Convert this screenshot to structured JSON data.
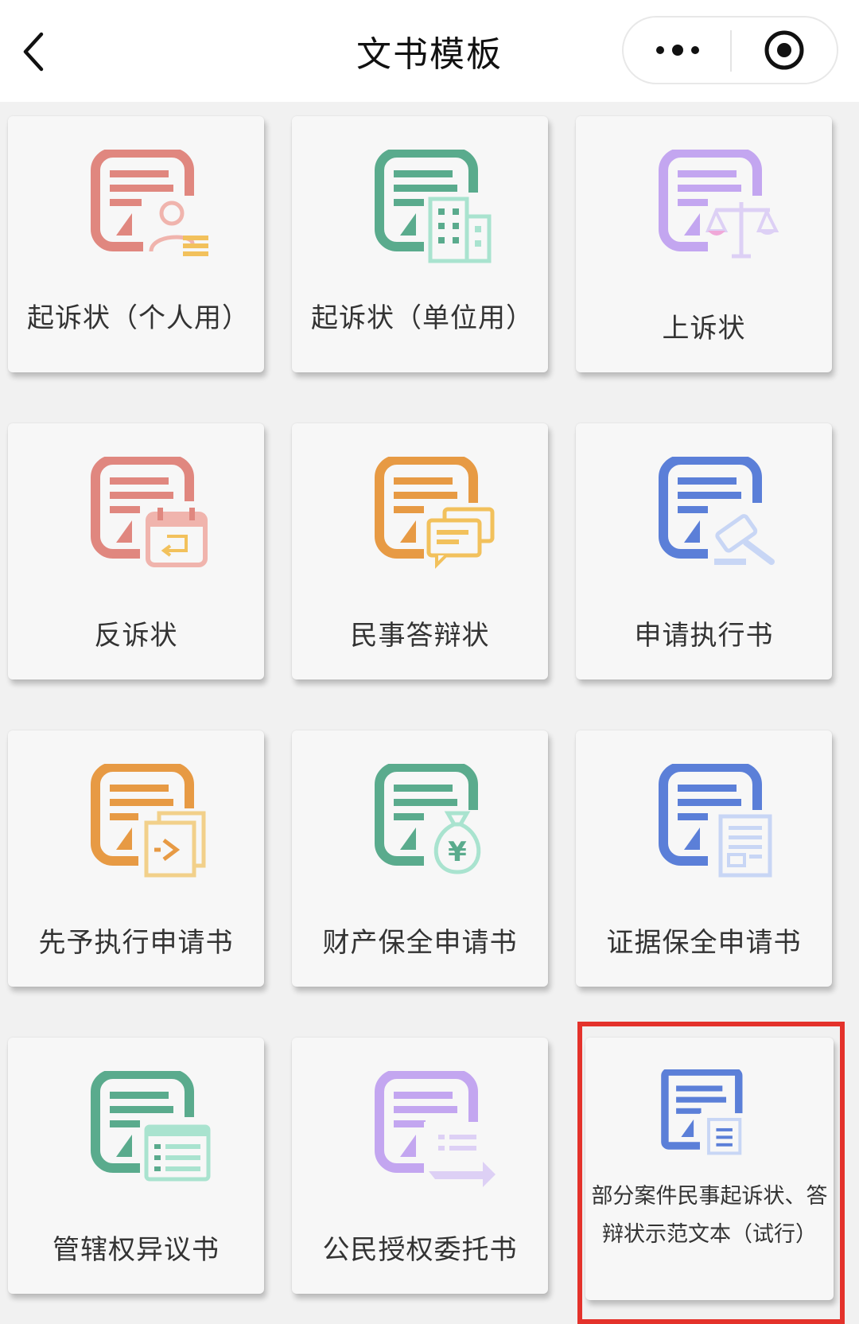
{
  "header": {
    "title": "文书模板"
  },
  "colors": {
    "red": "#e0877f",
    "green": "#5aab8d",
    "purple": "#c3a6f0",
    "orange": "#e79a44",
    "blue": "#5b7fd8",
    "highlight": "#e4322b"
  },
  "templates": [
    {
      "label": "起诉状（个人用）",
      "icon": "document-person-icon",
      "color": "red"
    },
    {
      "label": "起诉状（单位用）",
      "icon": "document-building-icon",
      "color": "green"
    },
    {
      "label": "上诉状",
      "icon": "document-scales-icon",
      "color": "purple"
    },
    {
      "label": "反诉状",
      "icon": "document-calendar-icon",
      "color": "red"
    },
    {
      "label": "民事答辩状",
      "icon": "document-chat-icon",
      "color": "orange"
    },
    {
      "label": "申请执行书",
      "icon": "document-gavel-icon",
      "color": "blue"
    },
    {
      "label": "先予执行申请书",
      "icon": "document-forward-icon",
      "color": "orange"
    },
    {
      "label": "财产保全申请书",
      "icon": "document-moneybag-icon",
      "color": "green"
    },
    {
      "label": "证据保全申请书",
      "icon": "document-sheet-icon",
      "color": "blue"
    },
    {
      "label": "管辖权异议书",
      "icon": "document-list-icon",
      "color": "green"
    },
    {
      "label": "公民授权委托书",
      "icon": "document-handover-icon",
      "color": "purple"
    },
    {
      "label": "部分案件民事起诉状、答辩状示范文本（试行）",
      "icon": "document-small-icon",
      "color": "blue",
      "highlighted": true
    }
  ]
}
